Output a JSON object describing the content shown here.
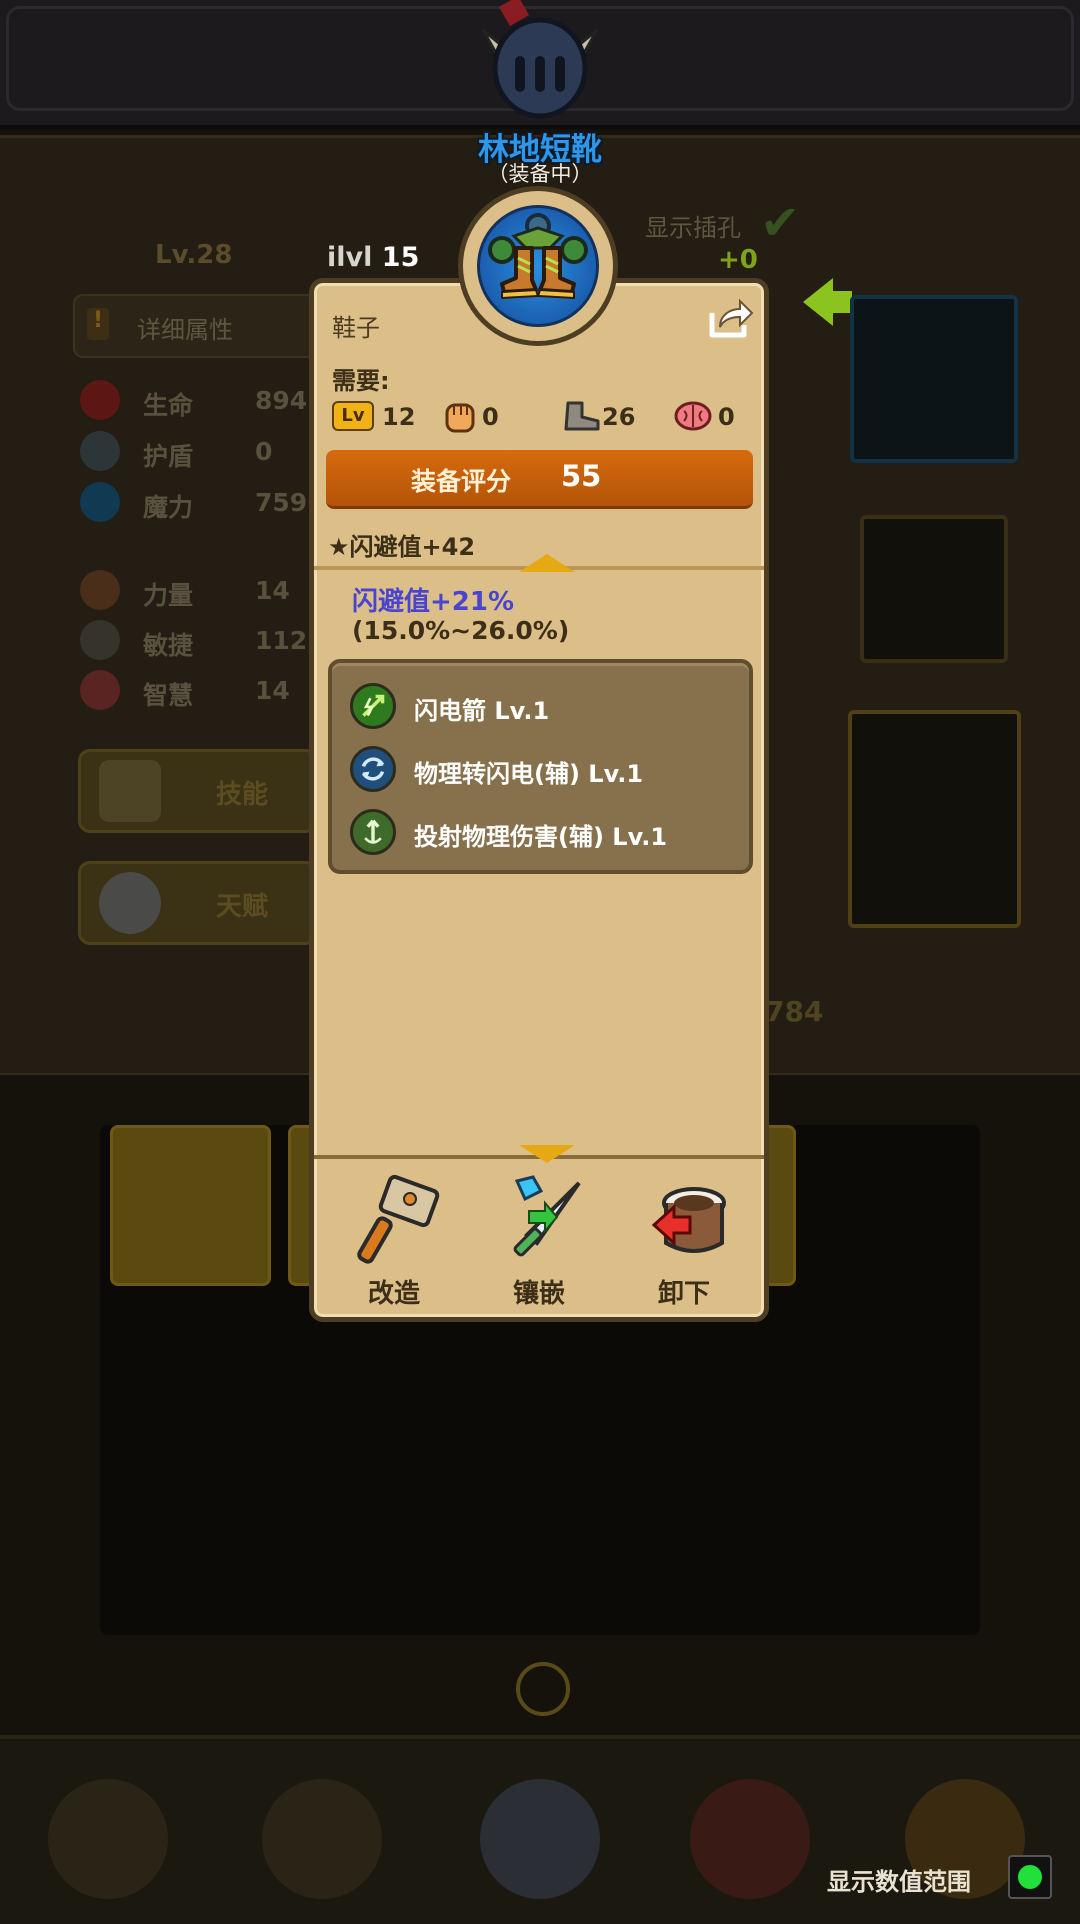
{
  "item": {
    "name": "林地短靴",
    "status": "（装备中）",
    "ilvl_label": "ilvl",
    "ilvl_value": "15",
    "type": "鞋子",
    "requirements_label": "需要:",
    "requirements": {
      "level_badge": "Lv",
      "level": "12",
      "strength": "0",
      "agility": "26",
      "wisdom": "0"
    },
    "score_label": "装备评分",
    "score_value": "55",
    "base_affix": "★闪避值+42",
    "bonus": "闪避值+21%",
    "bonus_range": "(15.0%~26.0%)",
    "skills": [
      {
        "name": "闪电箭  Lv.1",
        "icon": "lightning-arrow-icon",
        "color": "#2f7a1e"
      },
      {
        "name": "物理转闪电(辅)  Lv.1",
        "icon": "physical-to-lightning-icon",
        "color": "#1f4f7a"
      },
      {
        "name": "投射物理伤害(辅)  Lv.1",
        "icon": "projectile-damage-icon",
        "color": "#3f6b2a"
      }
    ],
    "actions": [
      {
        "label": "改造",
        "icon": "hammer-icon"
      },
      {
        "label": "镶嵌",
        "icon": "gem-sword-icon"
      },
      {
        "label": "卸下",
        "icon": "unequip-icon"
      }
    ]
  },
  "background": {
    "level": "Lv.28",
    "plus": "+0",
    "show_sockets": "显示插孔",
    "detail_button": "详细属性",
    "stats": [
      {
        "label": "生命",
        "value": "894",
        "color": "#a3231e"
      },
      {
        "label": "护盾",
        "value": "0",
        "color": "#4d5d63"
      },
      {
        "label": "魔力",
        "value": "759",
        "color": "#1b6f9a"
      },
      {
        "label": "力量",
        "value": "14",
        "color": "#7a4a2a"
      },
      {
        "label": "敏捷",
        "value": "112",
        "color": "#5a5448"
      },
      {
        "label": "智慧",
        "value": "14",
        "color": "#9a3a36"
      }
    ],
    "skills_button": "技能",
    "talent_button": "天赋",
    "power_value": "784",
    "show_range": "显示数值范围"
  },
  "colors": {
    "title_blue": "#2e97ea",
    "score_orange": "#d56b0c",
    "bonus_blue": "#4a45d0",
    "toggle_green": "#22e03a"
  }
}
